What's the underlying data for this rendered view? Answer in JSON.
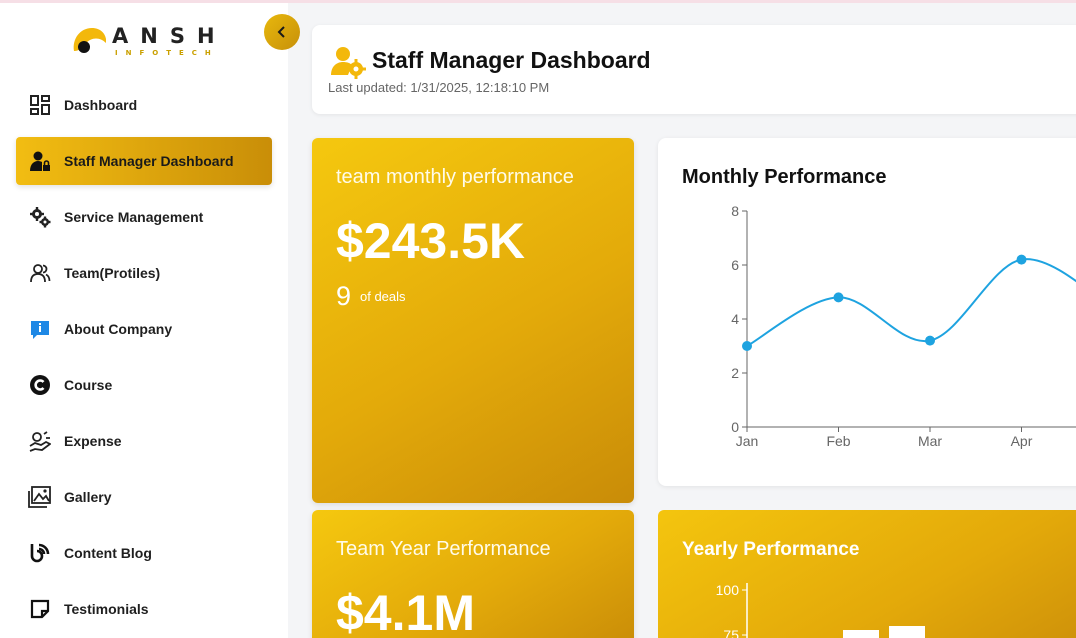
{
  "brand": {
    "name": "ANSH",
    "tagline": "INFOTECH"
  },
  "sidebar": {
    "items": [
      {
        "label": "Dashboard",
        "icon": "dashboard-grid-icon",
        "active": false
      },
      {
        "label": "Staff Manager Dashboard",
        "icon": "user-lock-icon",
        "active": true
      },
      {
        "label": "Service Management",
        "icon": "gears-icon",
        "active": false
      },
      {
        "label": "Team(Protiles)",
        "icon": "users-icon",
        "active": false
      },
      {
        "label": "About Company",
        "icon": "info-icon",
        "active": false
      },
      {
        "label": "Course",
        "icon": "copyright-icon",
        "active": false
      },
      {
        "label": "Expense",
        "icon": "hand-coin-icon",
        "active": false
      },
      {
        "label": "Gallery",
        "icon": "gallery-icon",
        "active": false
      },
      {
        "label": "Content Blog",
        "icon": "blog-icon",
        "active": false
      },
      {
        "label": "Testimonials",
        "icon": "note-icon",
        "active": false
      }
    ]
  },
  "header": {
    "title": "Staff Manager Dashboard",
    "last_updated": "Last updated: 1/31/2025, 12:18:10 PM"
  },
  "cards": {
    "monthly": {
      "title": "team monthly performance",
      "value": "$243.5K",
      "count": "9",
      "count_label": "of deals"
    },
    "yearly": {
      "title": "Team Year Performance",
      "value": "$4.1M"
    }
  },
  "colors": {
    "accent": "#f2bd12",
    "accent_dark": "#c98e08",
    "line": "#1ea3e0"
  },
  "chart_data": [
    {
      "type": "line",
      "title": "Monthly Performance",
      "categories": [
        "Jan",
        "Feb",
        "Mar",
        "Apr"
      ],
      "values": [
        3.0,
        4.8,
        3.2,
        6.2
      ],
      "ylim": [
        0,
        8
      ],
      "yticks": [
        0,
        2,
        4,
        6,
        8
      ],
      "color": "#1ea3e0",
      "grid": false
    },
    {
      "type": "bar",
      "title": "Yearly Performance",
      "yticks": [
        100,
        75
      ]
    }
  ]
}
